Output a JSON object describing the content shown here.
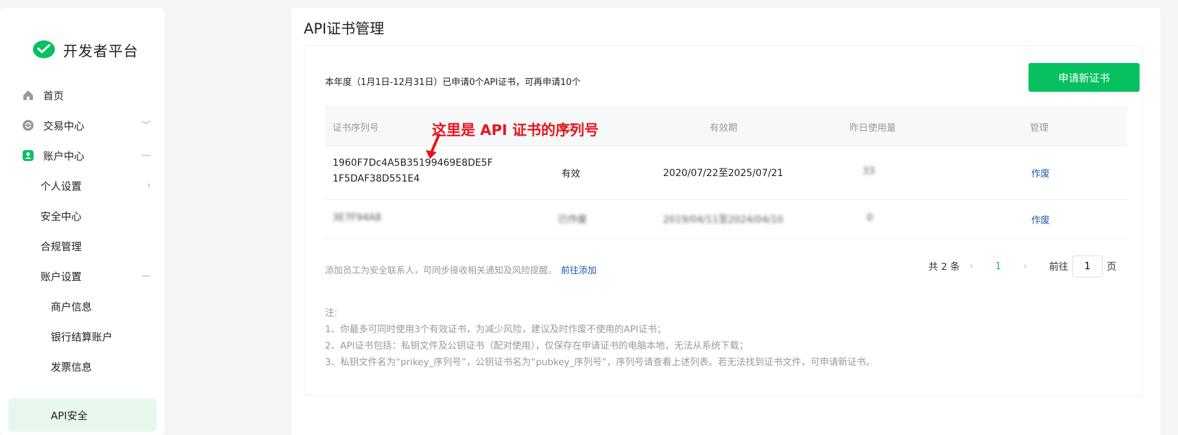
{
  "brand": {
    "name": "开发者平台",
    "accent": "#07c160"
  },
  "sidebar": {
    "items": [
      {
        "label": "首页",
        "icon": "home-icon",
        "chevron": ""
      },
      {
        "label": "交易中心",
        "icon": "transaction-icon",
        "chevron": "﹀"
      },
      {
        "label": "账户中心",
        "icon": "account-icon",
        "chevron": "—"
      },
      {
        "label": "个人设置",
        "chevron": "›"
      },
      {
        "label": "安全中心",
        "chevron": ""
      },
      {
        "label": "合规管理",
        "chevron": ""
      },
      {
        "label": "账户设置",
        "chevron": "—"
      },
      {
        "label": "商户信息",
        "chevron": ""
      },
      {
        "label": "银行结算账户",
        "chevron": ""
      },
      {
        "label": "发票信息",
        "chevron": ""
      },
      {
        "label": "API安全",
        "chevron": ""
      }
    ]
  },
  "main": {
    "title": "API证书管理",
    "summary": "本年度（1月1日-12月31日）已申请0个API证书，可再申请10个",
    "apply_button": "申请新证书",
    "table": {
      "headers": [
        "证书序列号",
        "状态",
        "有效期",
        "昨日使用量",
        "管理"
      ],
      "rows": [
        {
          "serial_line1": "1960F7Dc4A5B35199469E8DE5F",
          "serial_line2": "1F5DAF38D551E4",
          "status": "有效",
          "validity": "2020/07/22至2025/07/21",
          "usage": "33",
          "action": "作废"
        },
        {
          "serial_line1": "3E7F94A8",
          "status": "已作废",
          "validity": "2019/04/11至2024/04/10",
          "usage": "0",
          "action": "作废"
        }
      ]
    },
    "annotation": "这里是 API 证书的序列号",
    "tip": "添加员工为安全联系人，可同步接收相关通知及风险提醒。",
    "tip_link": "前往添加",
    "pager": {
      "total": "共 2 条",
      "prev": "‹",
      "current": "1",
      "next": "›",
      "goto": "前往",
      "goto_value": "1",
      "page_unit": "页"
    },
    "notes": {
      "title": "注:",
      "lines": [
        "1、你最多可同时使用3个有效证书，为减少风险，建议及时作废不使用的API证书；",
        "2、API证书包括：私钥文件及公钥证书（配对使用），仅保存在申请证书的电脑本地，无法从系统下载；",
        "3、私钥文件名为“prikey_序列号”，公钥证书名为“pubkey_序列号”，序列号请查看上述列表。若无法找到证书文件，可申请新证书。"
      ]
    }
  }
}
